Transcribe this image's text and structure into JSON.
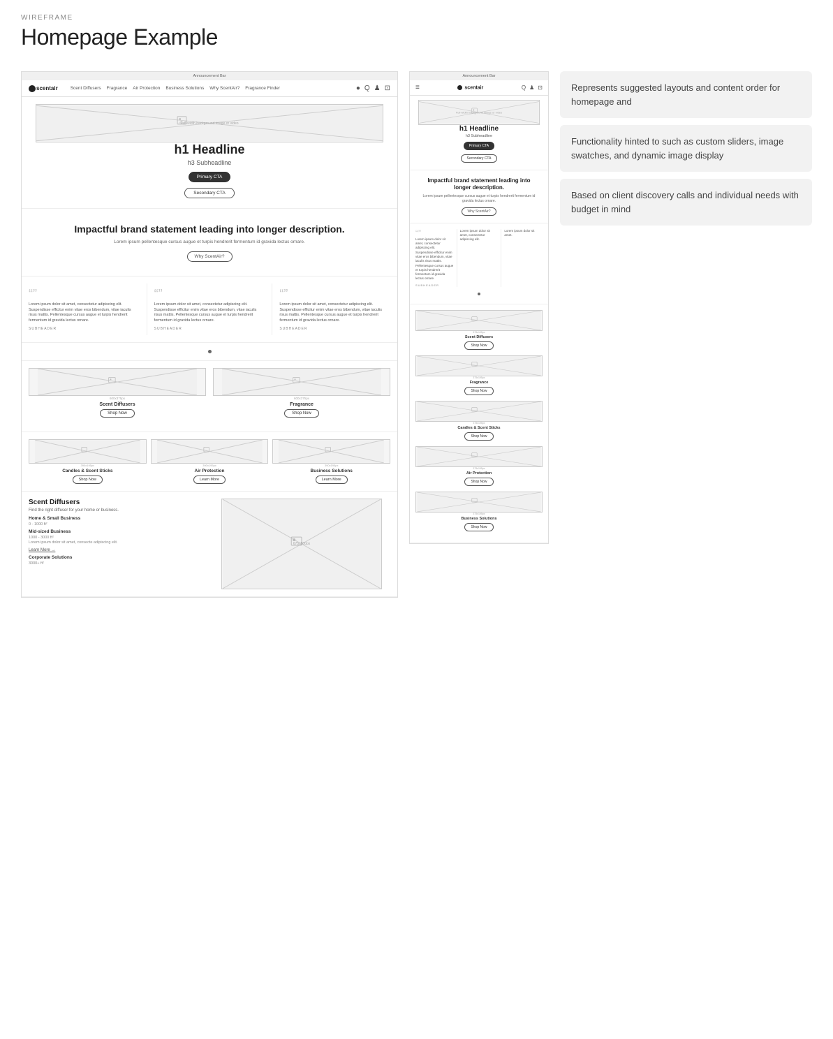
{
  "header": {
    "label": "WIREFRAME",
    "title": "Homepage Example"
  },
  "annotations": [
    {
      "id": "annotation-1",
      "text": "Represents suggested layouts and content order for homepage and"
    },
    {
      "id": "annotation-2",
      "text": "Functionality hinted to such as custom sliders, image swatches, and dynamic image display"
    },
    {
      "id": "annotation-3",
      "text": "Based on client discovery calls and individual needs with budget in mind"
    }
  ],
  "desktop_wireframe": {
    "announcement": "Announcement Bar",
    "nav": {
      "logo": "scentair",
      "links": [
        "Scent Diffusers",
        "Fragrance",
        "Air Protection",
        "Business Solutions",
        "Why ScentAir?",
        "Fragrance Finder"
      ],
      "icons": [
        "●",
        "Q",
        "♟",
        "⊡"
      ]
    },
    "hero": {
      "image_label": "Full-width background image or video",
      "h1": "h1 Headline",
      "h3": "h3 Subheadline",
      "cta_primary": "Primary CTA",
      "cta_secondary": "Secondary CTA"
    },
    "brand_statement": {
      "heading": "Impactful brand statement leading into longer description.",
      "body": "Lorem ipsum pellentesque cursus augue et turpis hendrerit fermentum id gravida lectus ornare.",
      "cta": "Why ScentAir?"
    },
    "testimonials": [
      {
        "quote": "Lorem ipsum dolor sit amet, consectetur adipiscing elit. Suspendisse efficitur enim vitae eros bibendum, vitae iaculis risus mattis. Pellentesque cursus augue et turpis hendrerit fermentum id gravida lectus ornare.",
        "subheader": "SUBHEADER"
      },
      {
        "quote": "Lorem ipsum dolor sit amet, consectetur adipiscing elit. Suspendisse efficitur enim vitae eros bibendum, vitae iaculis risus mattis. Pellentesque cursus augue et turpis hendrerit fermentum id gravida lectus ornare.",
        "subheader": "SUBHEADER"
      },
      {
        "quote": "Lorem ipsum dolor sit amet, consectetur adipiscing elit. Suspendisse efficitur enim vitae eros bibendum, vitae iaculis risus mattis. Pellentesque cursus augue et turpis hendrerit fermentum id gravida lectus ornare.",
        "subheader": "SUBHEADER"
      }
    ],
    "shop_categories": [
      {
        "image_label": "600x375px",
        "name": "Scent Diffusers",
        "cta": "Shop Now"
      },
      {
        "image_label": "600x375px",
        "name": "Fragrance",
        "cta": "Shop Now"
      }
    ],
    "more_categories": [
      {
        "image_label": "390x195px",
        "name": "Candles & Scent Sticks",
        "cta": "Shop Now"
      },
      {
        "image_label": "390x195px",
        "name": "Air Protection",
        "cta": "Learn More"
      },
      {
        "image_label": "390x195px",
        "name": "Business Solutions",
        "cta": "Learn More"
      }
    ],
    "finder": {
      "title": "Scent Diffusers",
      "description": "Find the right diffuser for your home or business.",
      "items": [
        {
          "name": "Home & Small Business",
          "range": "0 - 1000 ft²"
        },
        {
          "name": "Mid-sized Business",
          "range": "1000 - 3000 ft²",
          "body": "Lorem ipsum dolor sit amet, consecte adipiscing elit.",
          "link": "Learn More →"
        },
        {
          "name": "Corporate Solutions",
          "range": "3000+ ft²"
        }
      ],
      "image_label": "675x500px"
    }
  },
  "mobile_wireframe": {
    "announcement": "Announcement Bar",
    "nav": {
      "logo": "scentair",
      "icons": [
        "Q",
        "♟",
        "⊡"
      ]
    },
    "hero": {
      "image_label": "Full-width background image or video",
      "h1": "h1 Headline",
      "h3": "h3 Subheadline",
      "cta_primary": "Primary CTA",
      "cta_secondary": "Secondary CTA"
    },
    "brand_statement": {
      "heading": "Impactful brand statement leading into longer description.",
      "body": "Lorem ipsum pellentesque cursus augue et turpis hendrerit fermentum id gravida lectus ornare.",
      "cta": "Why ScentAir?"
    },
    "testimonial": {
      "quote": "Lorem ipsum dolor sit amet, consectetur adipiscing elit. Suspendisse efficitur enim vitae eros bibendum, vitae iaculis risus mattis. Pellentesque cursus augue et turpis hendrerit fermentum id gravida lectus ornare.",
      "subheader": "SUBHEADER"
    },
    "shop_categories": [
      {
        "image_label": "375x195px",
        "name": "Scent Diffusers",
        "cta": "Shop Now"
      },
      {
        "image_label": "375x195px",
        "name": "Fragrance",
        "cta": "Shop Now"
      },
      {
        "image_label": "375x195px",
        "name": "Candles & Scent Sticks",
        "cta": "Shop Now"
      },
      {
        "image_label": "375x195px",
        "name": "Air Protection",
        "cta": "Shop Now"
      },
      {
        "image_label": "375x195px",
        "name": "Business Solutions",
        "cta": "Shop Now"
      }
    ]
  }
}
